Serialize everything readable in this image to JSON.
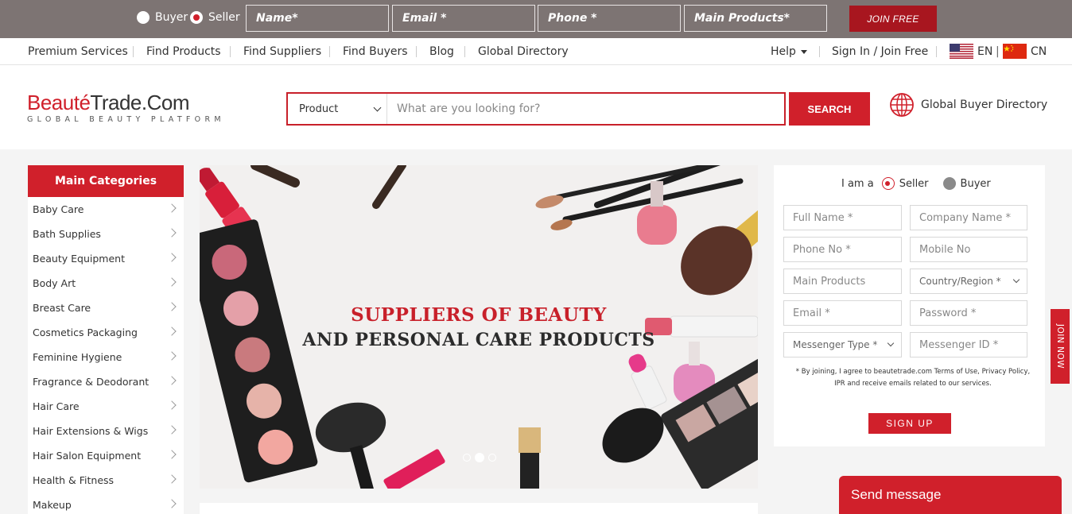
{
  "topbar": {
    "buyer_label": "Buyer",
    "seller_label": "Seller",
    "name_placeholder": "Name*",
    "email_placeholder": "Email *",
    "phone_placeholder": "Phone *",
    "products_placeholder": "Main Products*",
    "join_label": "JOIN FREE"
  },
  "nav": {
    "items": [
      "Premium Services",
      "Find Products",
      "Find Suppliers",
      "Find Buyers",
      "Blog",
      "Global Directory"
    ],
    "help": "Help",
    "signin": "Sign In / Join Free",
    "lang_en": "EN",
    "lang_sep": "|",
    "lang_cn": "CN"
  },
  "header": {
    "logo_part1": "Beauté",
    "logo_part2": "Trade.Com",
    "logo_tag": "GLOBAL BEAUTY PLATFORM",
    "search_type": "Product",
    "search_placeholder": "What are you looking for?",
    "search_button": "SEARCH",
    "global_buyer": "Global Buyer Directory"
  },
  "sidebar": {
    "title": "Main Categories",
    "items": [
      "Baby Care",
      "Bath Supplies",
      "Beauty Equipment",
      "Body Art",
      "Breast Care",
      "Cosmetics Packaging",
      "Feminine Hygiene",
      "Fragrance & Deodorant",
      "Hair Care",
      "Hair Extensions & Wigs",
      "Hair Salon Equipment",
      "Health & Fitness",
      "Makeup"
    ]
  },
  "banner": {
    "line1": "SUPPLIERS OF BEAUTY",
    "line2": "AND PERSONAL CARE PRODUCTS",
    "slide_count": 3,
    "active_slide": 2
  },
  "form": {
    "iam": "I am a",
    "seller": "Seller",
    "buyer": "Buyer",
    "full_name": "Full Name *",
    "company_name": "Company Name *",
    "phone_no": "Phone No *",
    "mobile_no": "Mobile No",
    "main_products": "Main Products",
    "country": "Country/Region *",
    "email": "Email *",
    "password": "Password *",
    "messenger_type": "Messenger Type *",
    "messenger_id": "Messenger ID *",
    "terms": "* By joining, I agree to beautetrade.com Terms of Use, Privacy Policy, IPR and receive emails related to our services.",
    "signup": "SIGN UP"
  },
  "join_tab": "JOIN NOW",
  "send_message": "Send message",
  "colors": {
    "brand_red": "#d0202b",
    "topbar_gray": "#7d7473",
    "join_button": "#a8161f"
  }
}
